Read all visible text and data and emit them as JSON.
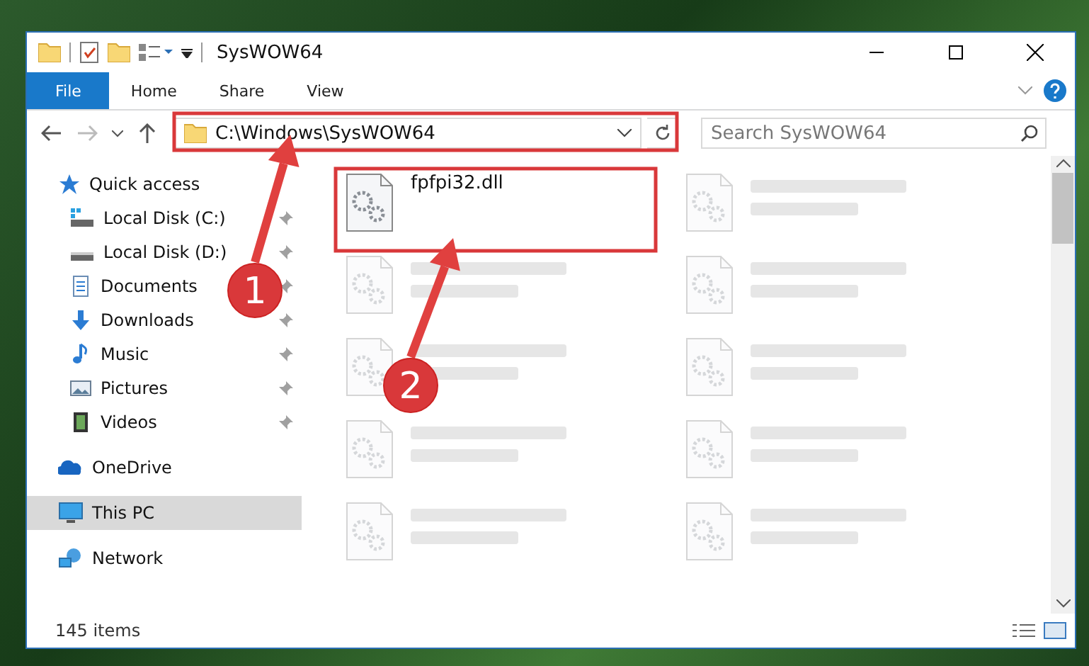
{
  "window": {
    "title": "SysWOW64"
  },
  "ribbon_tabs": [
    {
      "label": "File",
      "selected": true
    },
    {
      "label": "Home",
      "selected": false
    },
    {
      "label": "Share",
      "selected": false
    },
    {
      "label": "View",
      "selected": false
    }
  ],
  "address": {
    "value": "C:\\Windows\\SysWOW64"
  },
  "search": {
    "placeholder": "Search SysWOW64"
  },
  "sidebar": [
    {
      "label": "Quick access",
      "kind": "star",
      "selected": false,
      "children": [
        {
          "label": "Local Disk (C:)",
          "kind": "drive-win",
          "pinned": true,
          "selected": false
        },
        {
          "label": "Local Disk (D:)",
          "kind": "drive",
          "pinned": true,
          "selected": false
        },
        {
          "label": "Documents",
          "kind": "document",
          "pinned": true,
          "selected": false
        },
        {
          "label": "Downloads",
          "kind": "download",
          "pinned": true,
          "selected": false
        },
        {
          "label": "Music",
          "kind": "music",
          "pinned": true,
          "selected": false
        },
        {
          "label": "Pictures",
          "kind": "picture",
          "pinned": true,
          "selected": false
        },
        {
          "label": "Videos",
          "kind": "video",
          "pinned": true,
          "selected": false
        }
      ]
    },
    {
      "label": "OneDrive",
      "kind": "cloud",
      "selected": false
    },
    {
      "label": "This PC",
      "kind": "pc",
      "selected": true
    },
    {
      "label": "Network",
      "kind": "network",
      "selected": false
    }
  ],
  "files": [
    {
      "name": "fpfpi32.dll",
      "kind": "file"
    },
    {
      "kind": "blurred"
    },
    {
      "kind": "blurred"
    },
    {
      "kind": "blurred"
    },
    {
      "kind": "blurred"
    },
    {
      "kind": "blurred"
    },
    {
      "kind": "blurred"
    },
    {
      "kind": "blurred"
    },
    {
      "kind": "blurred"
    },
    {
      "kind": "blurred"
    }
  ],
  "status_bar": {
    "count": "145 items"
  },
  "callouts": [
    {
      "number": "1"
    },
    {
      "number": "2"
    }
  ]
}
